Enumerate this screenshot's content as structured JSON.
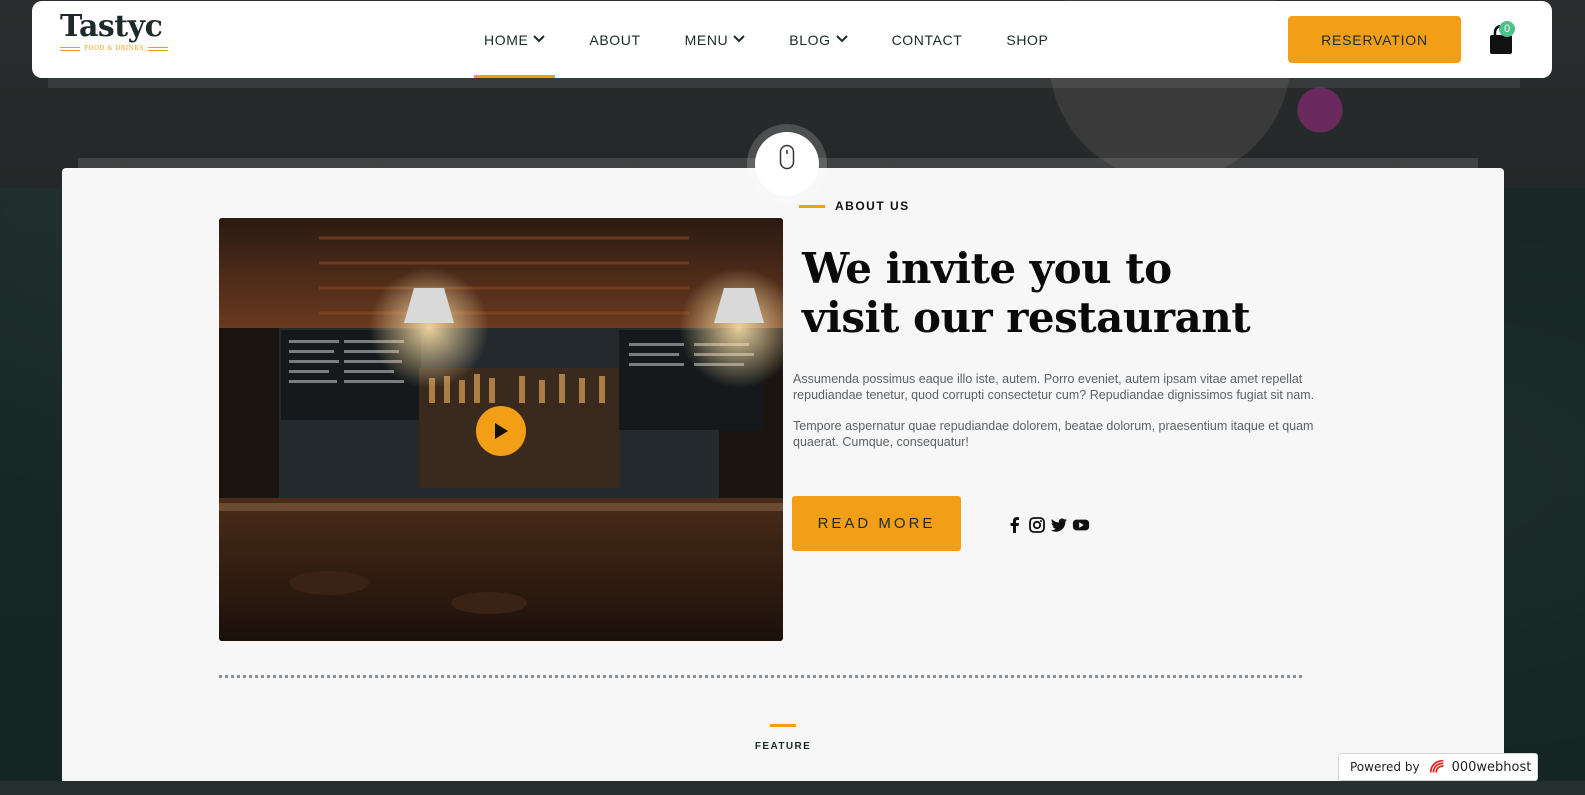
{
  "header": {
    "logo": {
      "name": "Tastyc",
      "tagline": "FOOD & DRINKS"
    },
    "nav": [
      {
        "label": "HOME",
        "has_dropdown": true,
        "active": true
      },
      {
        "label": "ABOUT",
        "has_dropdown": false
      },
      {
        "label": "MENU",
        "has_dropdown": true
      },
      {
        "label": "BLOG",
        "has_dropdown": true
      },
      {
        "label": "CONTACT",
        "has_dropdown": false
      },
      {
        "label": "SHOP",
        "has_dropdown": false
      }
    ],
    "reservation_label": "RESERVATION",
    "cart_count": "0"
  },
  "about": {
    "eyebrow": "ABOUT US",
    "headline_line1": "We invite you to",
    "headline_line2": "visit our restaurant",
    "paragraph1": "Assumenda possimus eaque illo iste, autem. Porro eveniet, autem ipsam vitae amet repellat repudiandae tenetur, quod corrupti consectetur cum? Repudiandae dignissimos fugiat sit nam.",
    "paragraph2": "Tempore aspernatur quae repudiandae dolorem, beatae dolorum, praesentium itaque et quam quaerat. Cumque, consequatur!",
    "read_more_label": "READ MORE",
    "socials": [
      "facebook-icon",
      "instagram-icon",
      "twitter-icon",
      "youtube-icon"
    ]
  },
  "feature": {
    "label": "FEATURE"
  },
  "powered_by": {
    "prefix": "Powered by",
    "brand": "000webhost"
  },
  "colors": {
    "accent": "#f29e16",
    "dark": "#1c2a2a",
    "badge": "#4ec08c"
  }
}
